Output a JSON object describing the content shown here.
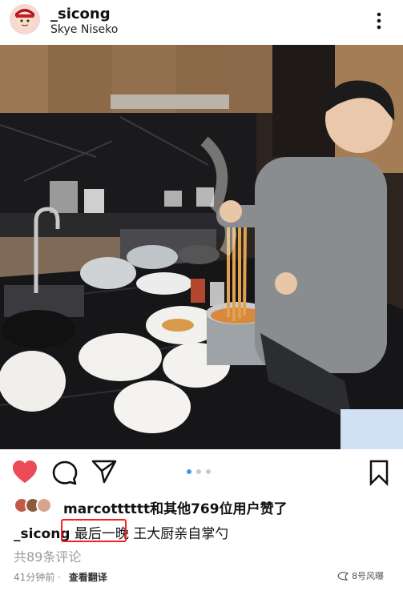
{
  "header": {
    "username": "_sicong",
    "location": "Skye Niseko"
  },
  "photo": {
    "alt_subject": "kitchen-cooking-photo"
  },
  "carousel": {
    "count": 3,
    "active_index": 0
  },
  "likes": {
    "text": "marcotttttt和其他769位用户赞了"
  },
  "caption": {
    "username": "_sicong",
    "highlighted": "最后一晚",
    "rest": "王大厨亲自掌勺",
    "highlight_color": "#ff1c1c"
  },
  "comments": {
    "label": "共89条评论"
  },
  "meta": {
    "time": "41分钟前",
    "separator": "·",
    "translate_label": "查看翻译"
  },
  "watermark": {
    "text": "8号风曝"
  },
  "colors": {
    "heart": "#ed4956",
    "carousel_active": "#3797f0",
    "carousel_inactive": "#c9c9c9"
  },
  "icons": [
    "avatar-icon",
    "more-icon",
    "heart-icon",
    "comment-icon",
    "send-icon",
    "bookmark-icon",
    "watermark-icon"
  ]
}
